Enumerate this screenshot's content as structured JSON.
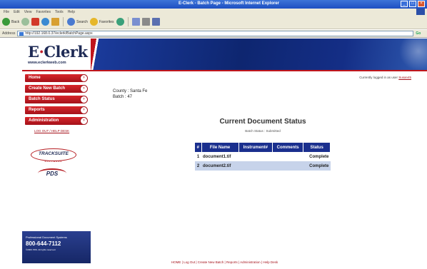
{
  "window": {
    "title": "E-Clerk - Batch Page - Microsoft Internet Explorer",
    "buttons": [
      "_",
      "□",
      "×"
    ]
  },
  "menubar": [
    "File",
    "Edit",
    "View",
    "Favorites",
    "Tools",
    "Help"
  ],
  "toolbar": {
    "back_label": "Back",
    "search_label": "Search",
    "favorites_label": "Favorites"
  },
  "address": {
    "label": "Address",
    "url": "http://192.168.0.37/eclerk/BatchPage.aspx",
    "go_label": "Go"
  },
  "header": {
    "logo_text": "E",
    "logo_dot": "·",
    "logo_text2": "Clerk",
    "logo_url": "www.eclerkweb.com"
  },
  "sidebar": {
    "items": [
      {
        "label": "Home"
      },
      {
        "label": "Create New Batch"
      },
      {
        "label": "Batch Status"
      },
      {
        "label": "Reports"
      },
      {
        "label": "Administration"
      }
    ],
    "logout": "LOG OUT / HELP DESK",
    "tracksuite": "TRACKSUITE",
    "tracksuite_sub": "SOFTWARE",
    "pds": "PDS",
    "footer": {
      "company": "Professional Document Systems",
      "phone": "800-644-7112",
      "copyright": "©2006 PDS. All rights reserved."
    }
  },
  "main": {
    "logged_in_prefix": "Currently logged in as user",
    "logged_in_user": "Susan45",
    "county_line": "County : Santa Fe",
    "batch_line": "Batch : 47",
    "doc_title": "Current Document Status",
    "batch_status": "Batch Status : Submitted",
    "table": {
      "headers": [
        "#",
        "File Name",
        "Instrument#",
        "Comments",
        "Status"
      ],
      "rows": [
        {
          "num": "1",
          "file": "document1.tif",
          "instrument": "",
          "comments": "",
          "status": "Complete"
        },
        {
          "num": "2",
          "file": "document2.tif",
          "instrument": "",
          "comments": "",
          "status": "Complete"
        }
      ]
    }
  },
  "footer_links": "HOME | Log Out | Create New Batch | Reports | Administration | Help Desk"
}
